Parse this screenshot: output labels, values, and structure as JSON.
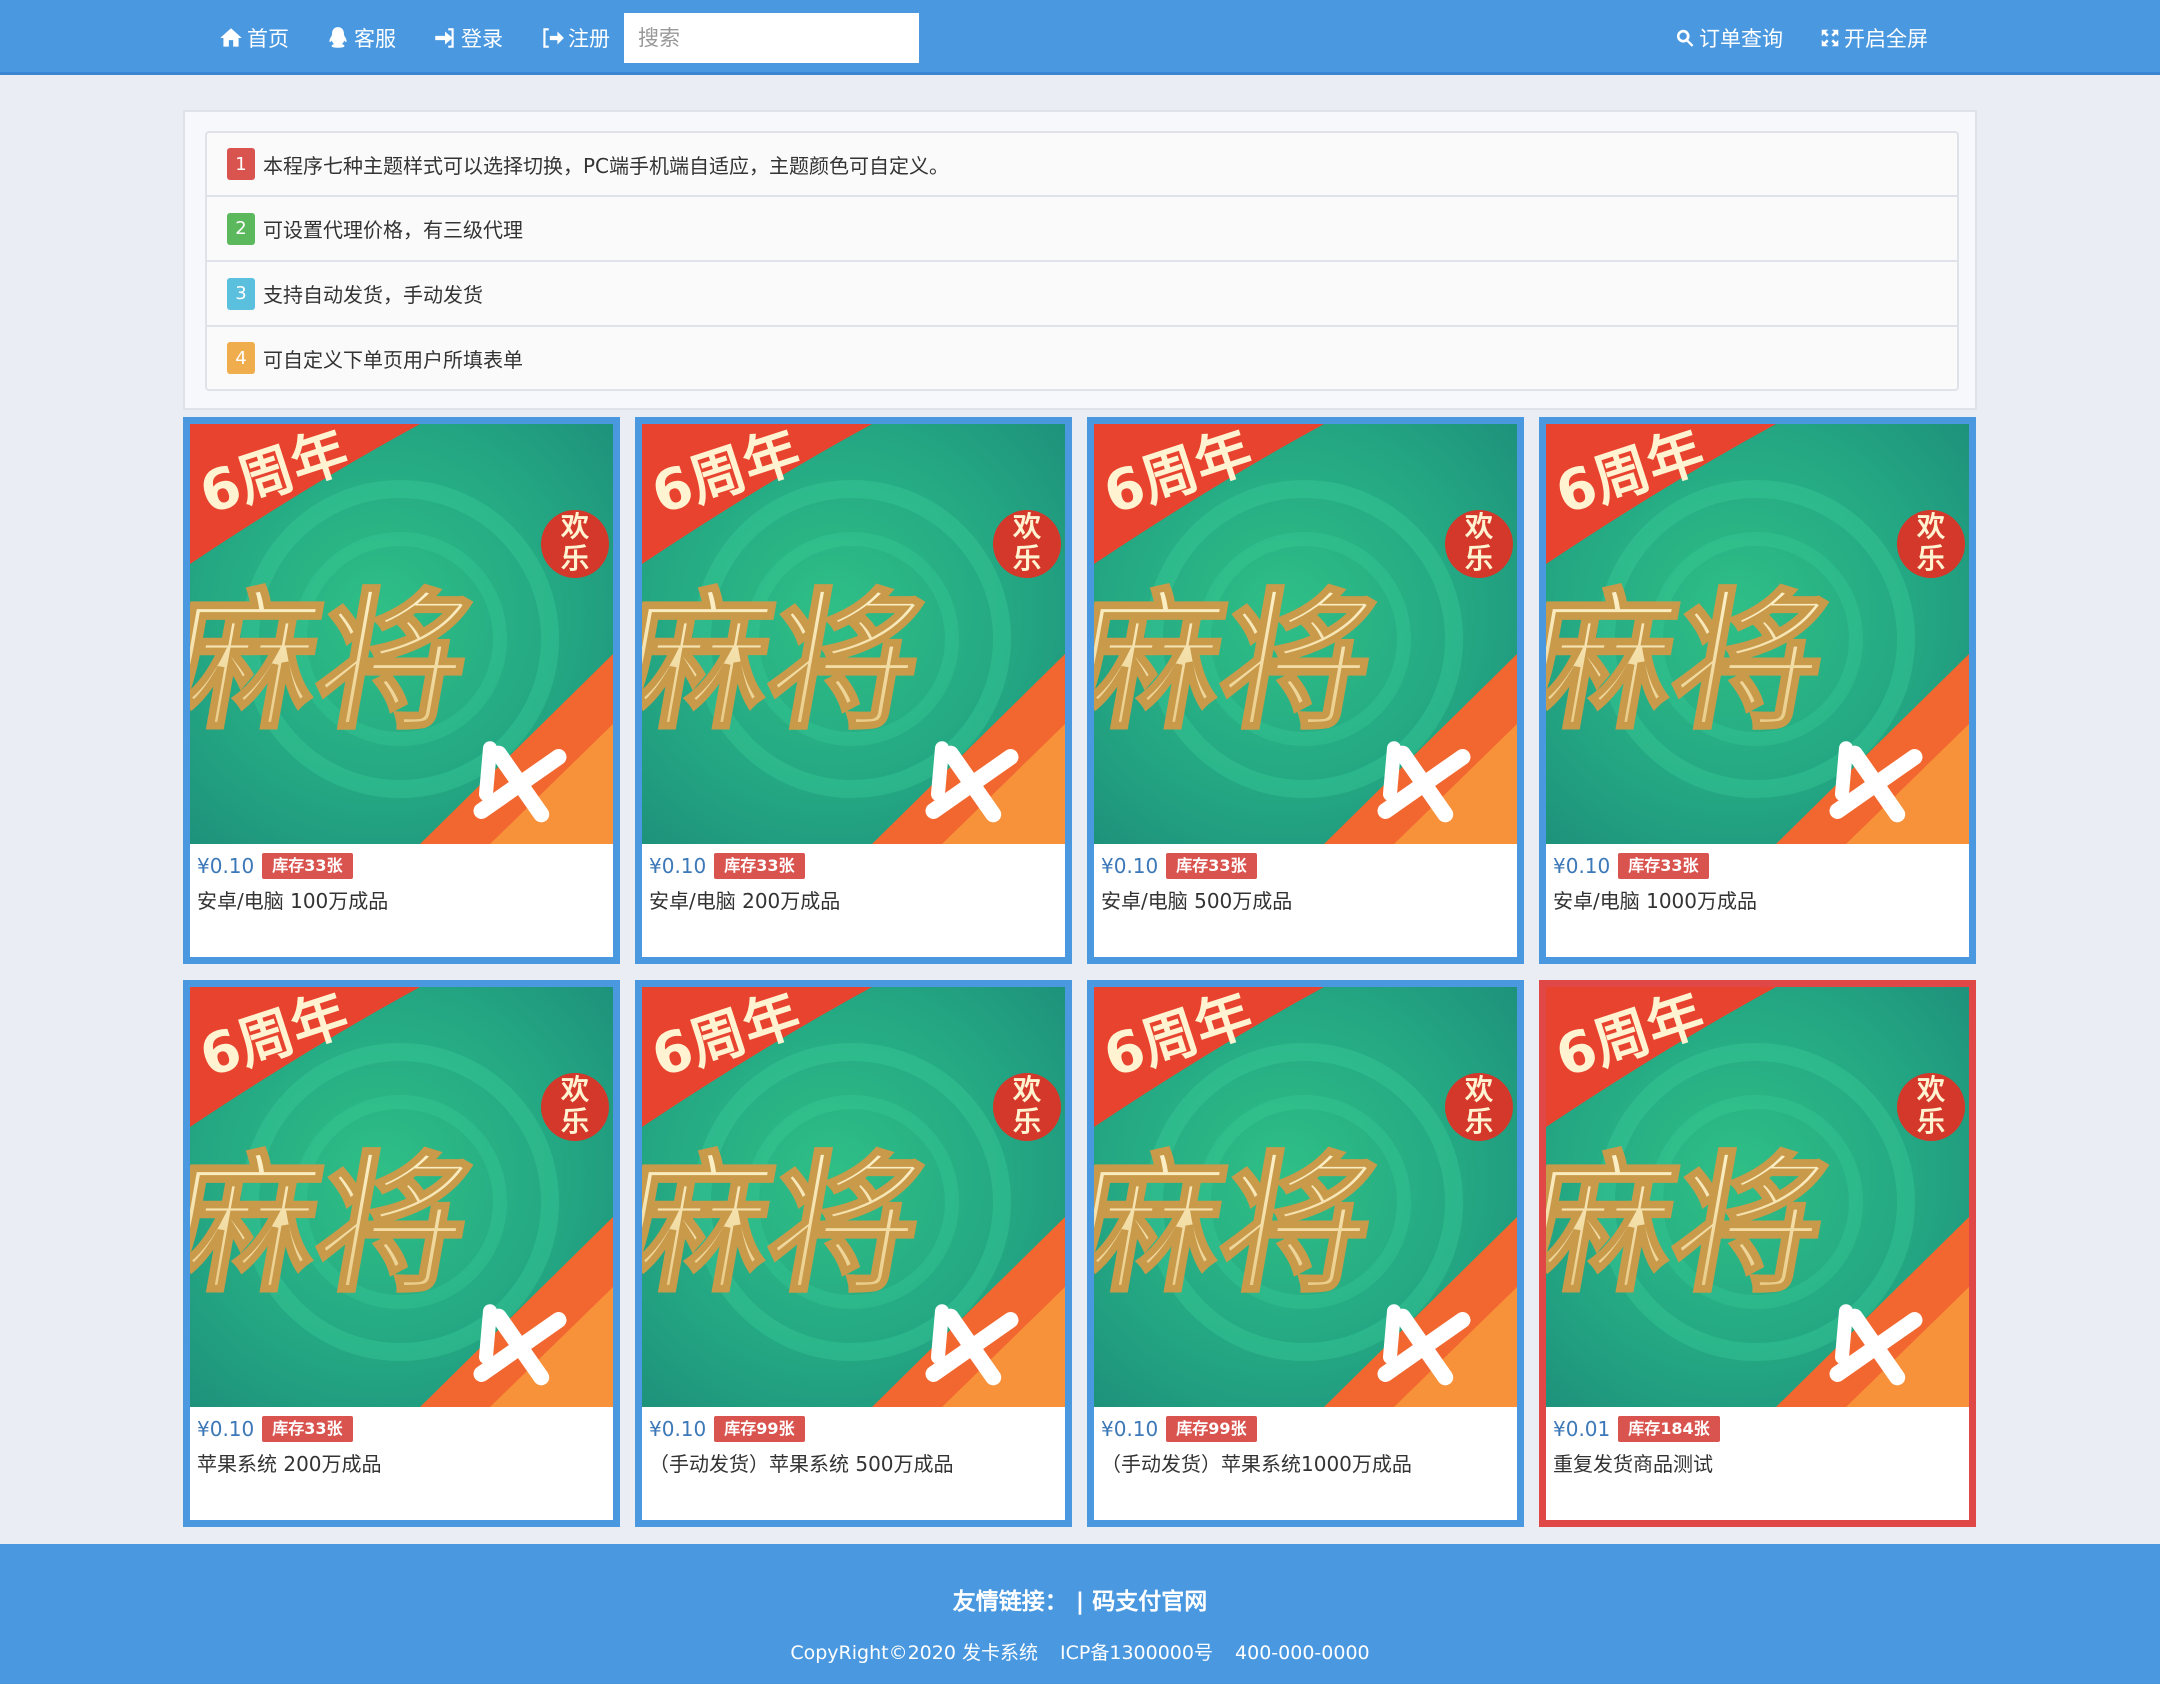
{
  "nav": {
    "home": "首页",
    "support": "客服",
    "login": "登录",
    "register": "注册",
    "search_placeholder": "搜索",
    "order_query": "订单查询",
    "fullscreen": "开启全屏"
  },
  "notices": [
    {
      "num": "1",
      "color": "#d9534f",
      "text": "本程序七种主题样式可以选择切换，PC端手机端自适应，主题颜色可自定义。"
    },
    {
      "num": "2",
      "color": "#5cb85c",
      "text": "可设置代理价格，有三级代理"
    },
    {
      "num": "3",
      "color": "#5bc0de",
      "text": "支持自动发货，手动发货"
    },
    {
      "num": "4",
      "color": "#f0ad4e",
      "text": "可自定义下单页用户所填表单"
    }
  ],
  "products": [
    {
      "price": "¥0.10",
      "stock": "库存33张",
      "name": "安卓/电脑 100万成品"
    },
    {
      "price": "¥0.10",
      "stock": "库存33张",
      "name": "安卓/电脑 200万成品"
    },
    {
      "price": "¥0.10",
      "stock": "库存33张",
      "name": "安卓/电脑 500万成品"
    },
    {
      "price": "¥0.10",
      "stock": "库存33张",
      "name": "安卓/电脑 1000万成品"
    },
    {
      "price": "¥0.10",
      "stock": "库存33张",
      "name": "苹果系统 200万成品"
    },
    {
      "price": "¥0.10",
      "stock": "库存99张",
      "name": "（手动发货）苹果系统 500万成品"
    },
    {
      "price": "¥0.10",
      "stock": "库存99张",
      "name": "（手动发货）苹果系统1000万成品"
    },
    {
      "price": "¥0.01",
      "stock": "库存184张",
      "name": "重复发货商品测试"
    }
  ],
  "product_image": {
    "line1": "6周年",
    "line2": "麻将",
    "badge": "欢乐"
  },
  "footer": {
    "links_label": "友情链接：",
    "link1": "码支付官网",
    "copyright": "CopyRight©2020 发卡系统",
    "icp": "ICP备1300000号",
    "phone": "400-000-0000"
  },
  "colors": {
    "accent": "#4a99e0",
    "selected_border": "#e04848"
  }
}
